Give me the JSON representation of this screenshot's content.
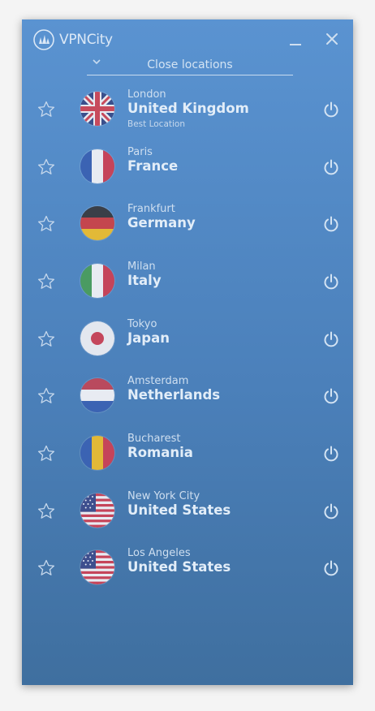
{
  "app": {
    "brand": "VPNCity",
    "icons": {
      "minimize": "minimize-icon",
      "close": "close-icon",
      "logo": "vpncity-logo-icon"
    }
  },
  "location_filter": {
    "selected": "Close locations",
    "icon": "chevron-down-icon"
  },
  "locations": [
    {
      "city": "London",
      "country": "United Kingdom",
      "note": "Best Location",
      "flag": "uk-flag-icon"
    },
    {
      "city": "Paris",
      "country": "France",
      "note": "",
      "flag": "france-flag-icon"
    },
    {
      "city": "Frankfurt",
      "country": "Germany",
      "note": "",
      "flag": "germany-flag-icon"
    },
    {
      "city": "Milan",
      "country": "Italy",
      "note": "",
      "flag": "italy-flag-icon"
    },
    {
      "city": "Tokyo",
      "country": "Japan",
      "note": "",
      "flag": "japan-flag-icon"
    },
    {
      "city": "Amsterdam",
      "country": "Netherlands",
      "note": "",
      "flag": "netherlands-flag-icon"
    },
    {
      "city": "Bucharest",
      "country": "Romania",
      "note": "",
      "flag": "romania-flag-icon"
    },
    {
      "city": "New York City",
      "country": "United States",
      "note": "",
      "flag": "usa-flag-icon"
    },
    {
      "city": "Los Angeles",
      "country": "United States",
      "note": "",
      "flag": "usa-flag-icon"
    }
  ],
  "colors": {
    "window_top": "#5a93d1",
    "window_bottom": "#3f6f9f",
    "text": "#dbe8f6"
  }
}
